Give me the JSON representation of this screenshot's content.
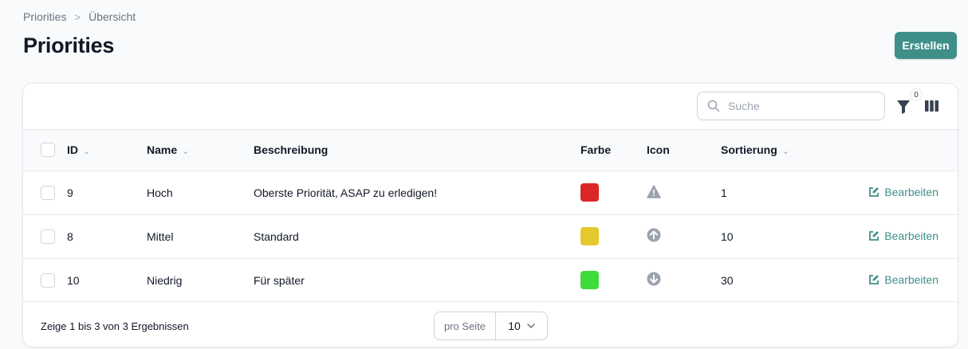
{
  "breadcrumb": {
    "root": "Priorities",
    "separator": ">",
    "current": "Übersicht"
  },
  "page": {
    "title": "Priorities",
    "create_label": "Erstellen"
  },
  "colors": {
    "accent": "#3f8f89"
  },
  "toolbar": {
    "search_placeholder": "Suche",
    "search_value": "",
    "filter_count": "0",
    "filter_icon": "funnel-icon",
    "columns_icon": "columns-icon"
  },
  "table": {
    "headers": {
      "id": "ID",
      "name": "Name",
      "description": "Beschreibung",
      "color": "Farbe",
      "icon": "Icon",
      "sort": "Sortierung"
    },
    "rows": [
      {
        "id": "9",
        "name": "Hoch",
        "description": "Oberste Priorität, ASAP zu erledigen!",
        "color": "#dc2626",
        "icon": "warning-triangle-icon",
        "sort": "1",
        "action": "Bearbeiten"
      },
      {
        "id": "8",
        "name": "Mittel",
        "description": "Standard",
        "color": "#e5c82e",
        "icon": "arrow-up-circle-icon",
        "sort": "10",
        "action": "Bearbeiten"
      },
      {
        "id": "10",
        "name": "Niedrig",
        "description": "Für später",
        "color": "#3ddc3a",
        "icon": "arrow-down-circle-icon",
        "sort": "30",
        "action": "Bearbeiten"
      }
    ]
  },
  "footer": {
    "summary": "Zeige 1 bis 3 von 3 Ergebnissen",
    "per_page_label": "pro Seite",
    "per_page_value": "10"
  }
}
